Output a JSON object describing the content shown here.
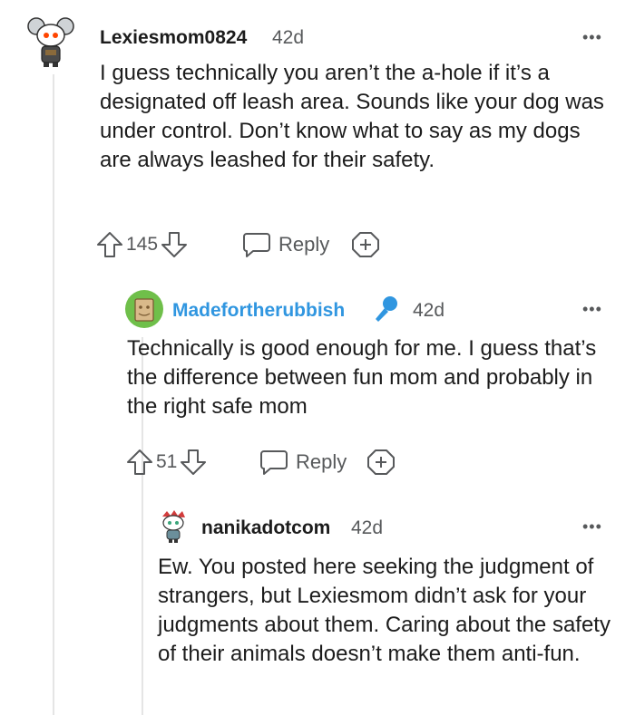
{
  "comments": [
    {
      "username": "Lexiesmom0824",
      "time": "42d",
      "more": "•••",
      "body": "I guess technically you aren’t the a-hole if it’s a designated off leash area. Sounds like your dog was under control. Don’t know what to say as my dogs are always leashed for their safety.",
      "votes": "145",
      "reply_label": "Reply"
    },
    {
      "username": "Madefortherubbish",
      "username_color": "#3096e0",
      "time": "42d",
      "more": "•••",
      "body": "Technically is good enough for me. I guess that’s the difference between fun mom and probably in the right safe mom",
      "votes": "51",
      "reply_label": "Reply"
    },
    {
      "username": "nanikadotcom",
      "time": "42d",
      "more": "•••",
      "body": "Ew. You posted here seeking the judgment of strangers, but Lexiesmom didn’t ask for your judgments about them. Caring about the safety of their animals doesn’t make them anti-fun."
    }
  ],
  "colors": {
    "meta": "#57595b",
    "text": "#1c1c1c",
    "op_blue": "#3096e0",
    "thread_line": "#e5e5e5"
  }
}
